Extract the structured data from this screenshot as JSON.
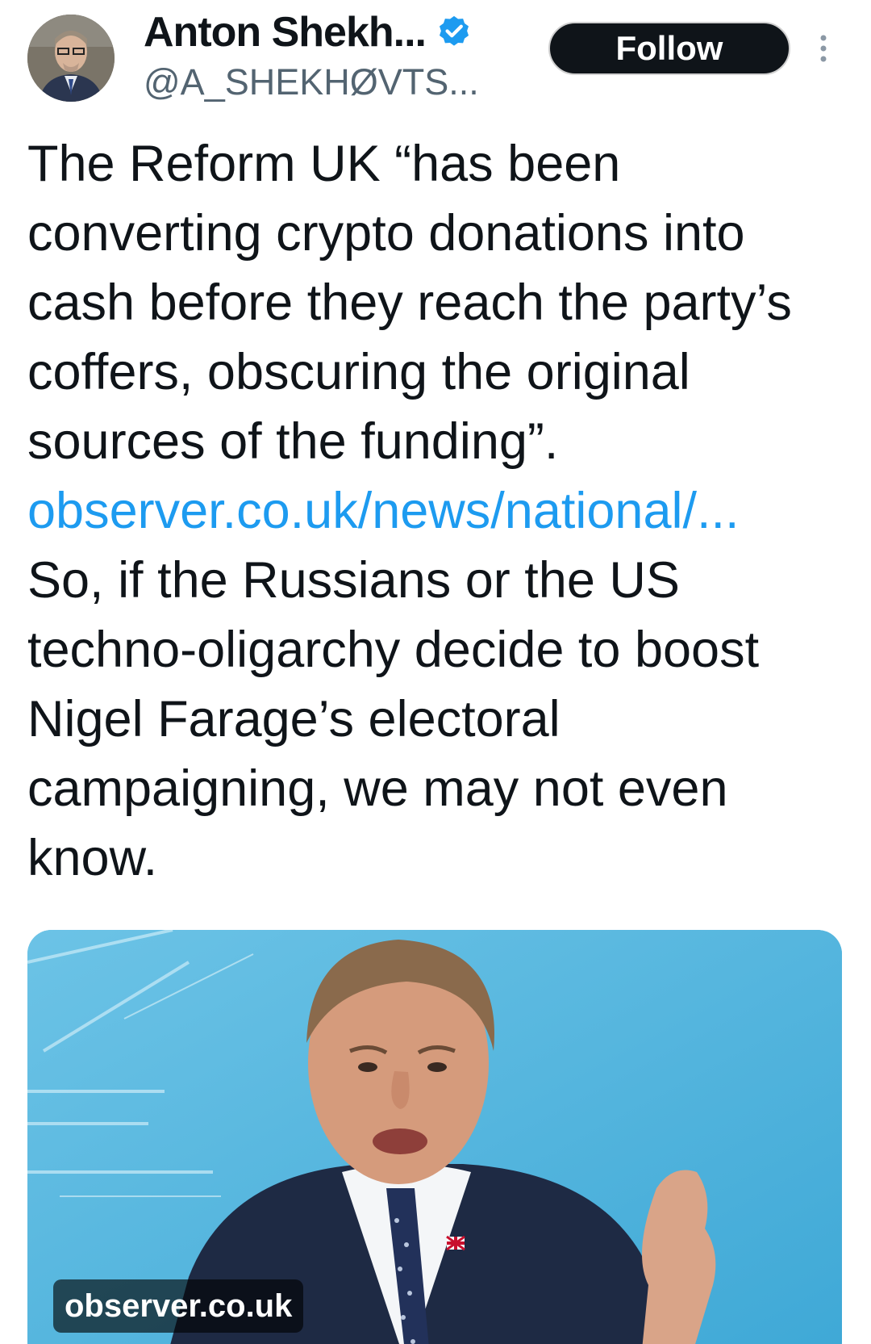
{
  "author": {
    "display_name": "Anton Shekh...",
    "handle": "@A_SHEKHØVTS...",
    "verified": true,
    "avatar_icon": "profile-photo"
  },
  "actions": {
    "follow_label": "Follow",
    "more_icon": "vertical-ellipsis-icon"
  },
  "tweet": {
    "paragraph_1": "The Reform UK “has been converting crypto donations into cash before they reach the party’s coffers, obscuring the original sources of the funding”.",
    "link_text": "observer.co.uk/news/national/...",
    "paragraph_2": "So, if the Russians or the US techno-oligarchy decide to boost Nigel Farage’s electoral campaigning, we may not even know."
  },
  "media": {
    "source_label": "observer.co.uk"
  },
  "colors": {
    "text": "#0f1419",
    "secondary_text": "#536471",
    "link": "#1d9bf0",
    "verified_badge": "#1d9bf0",
    "follow_button_bg": "#0f1419",
    "media_background": "#58b9de"
  }
}
